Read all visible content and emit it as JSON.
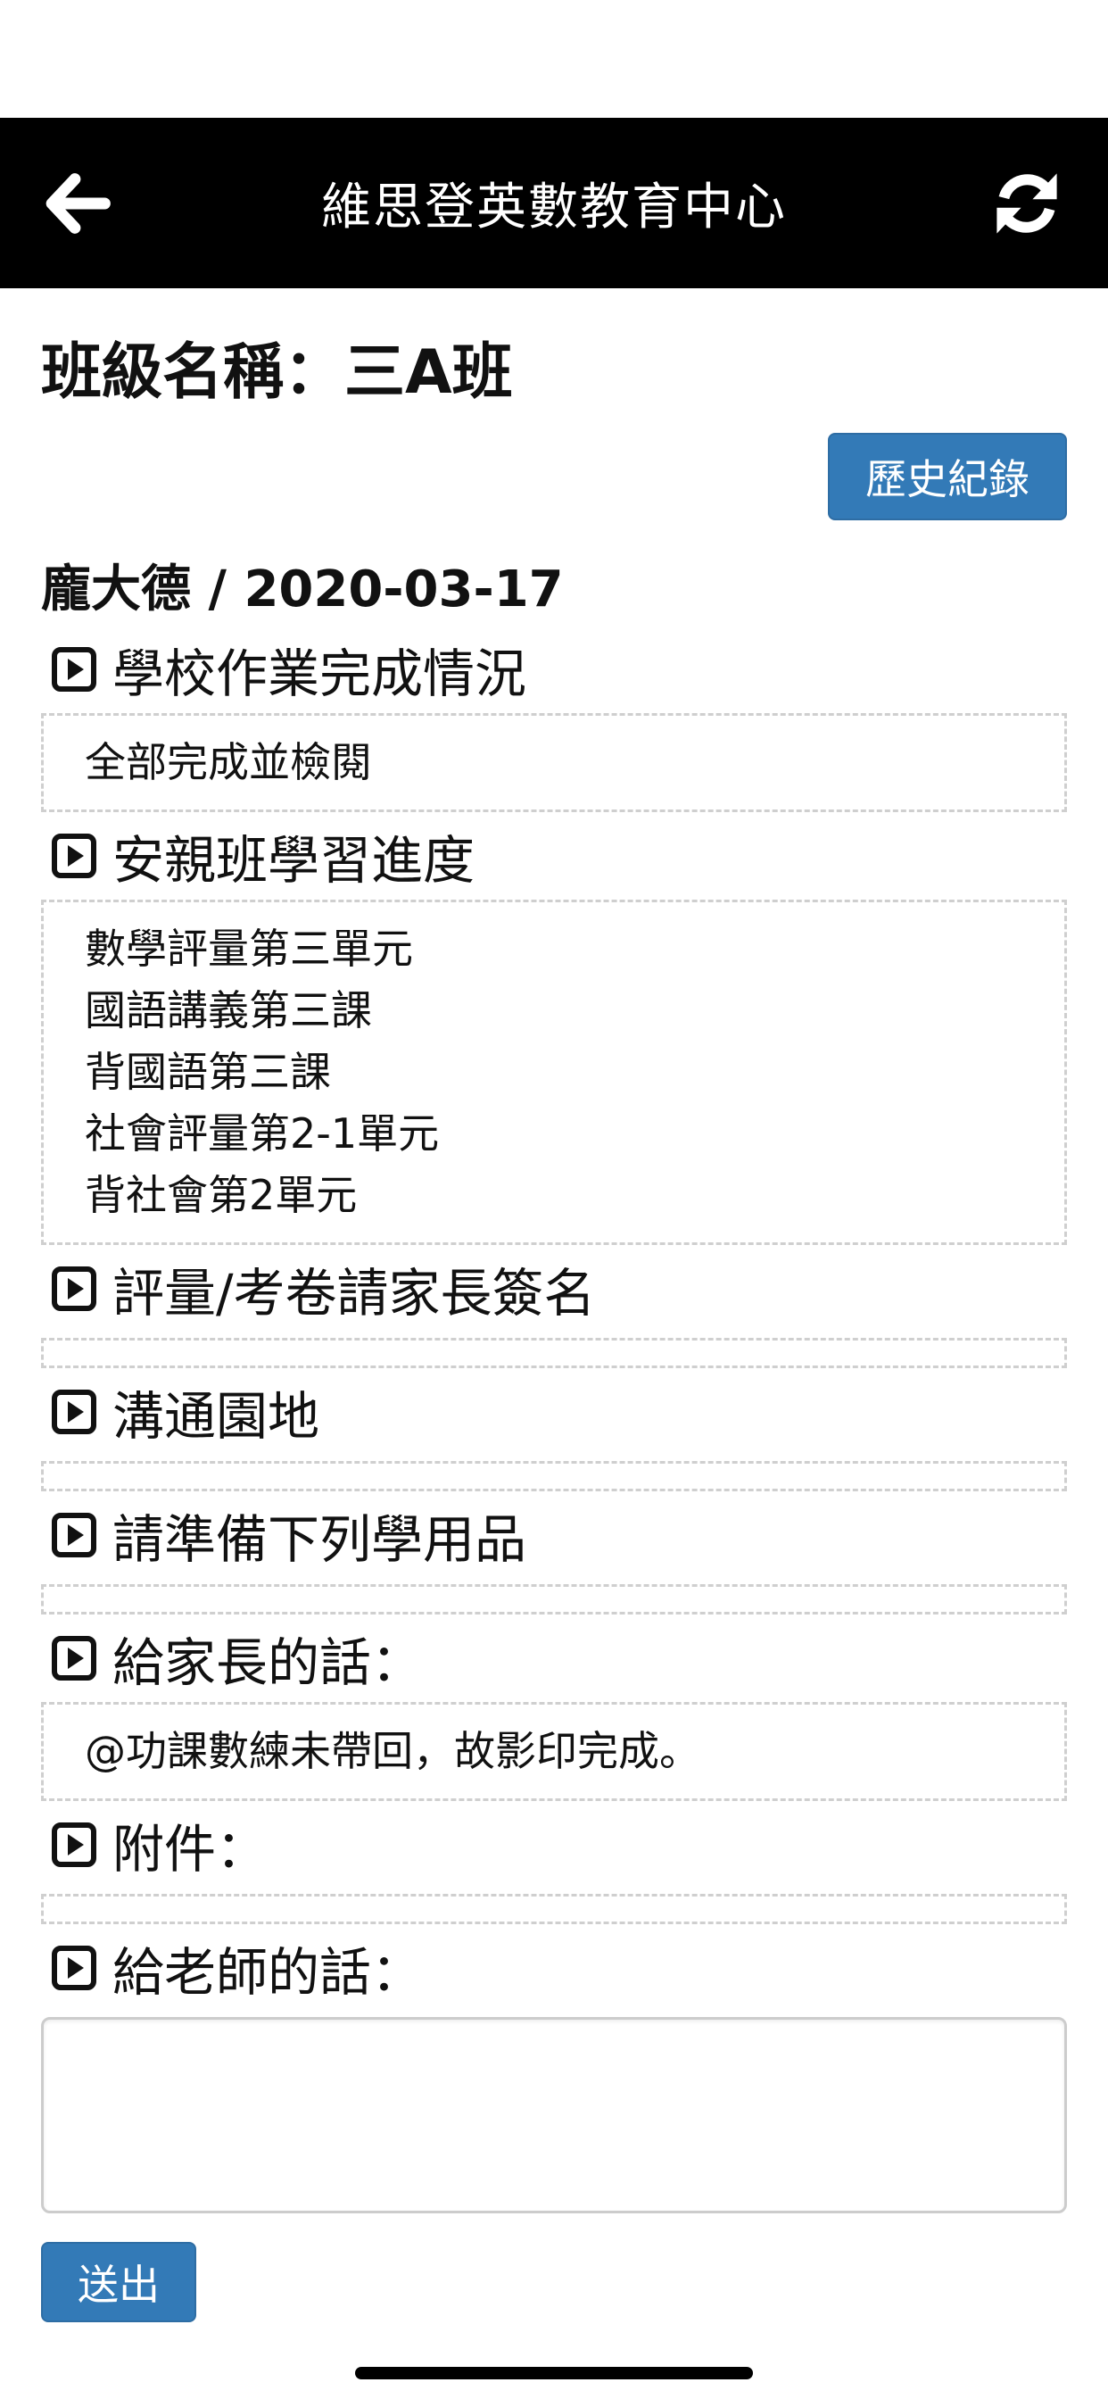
{
  "header": {
    "title": "維思登英數教育中心"
  },
  "page": {
    "class_title": "班級名稱：三A班",
    "history_label": "歷史紀錄",
    "student_line": "龐大德 / 2020-03-17"
  },
  "sections": {
    "school_homework": {
      "heading": "學校作業完成情況",
      "lines": [
        "全部完成並檢閱"
      ]
    },
    "progress": {
      "heading": "安親班學習進度",
      "lines": [
        "數學評量第三單元",
        "國語講義第三課",
        "背國語第三課",
        "社會評量第2-1單元",
        "背社會第2單元"
      ]
    },
    "sign": {
      "heading": "評量/考卷請家長簽名"
    },
    "communication": {
      "heading": "溝通園地"
    },
    "supplies": {
      "heading": "請準備下列學用品"
    },
    "to_parent": {
      "heading": "給家長的話：",
      "lines": [
        "@功課數練未帶回，故影印完成。"
      ]
    },
    "attachment": {
      "heading": "附件："
    },
    "to_teacher": {
      "heading": "給老師的話："
    }
  },
  "submit_label": "送出",
  "icons": {
    "back": "arrow-left-icon",
    "refresh": "refresh-icon",
    "section": "play-square-icon"
  },
  "colors": {
    "nav_background": "#000000",
    "button": "#337ab7"
  }
}
